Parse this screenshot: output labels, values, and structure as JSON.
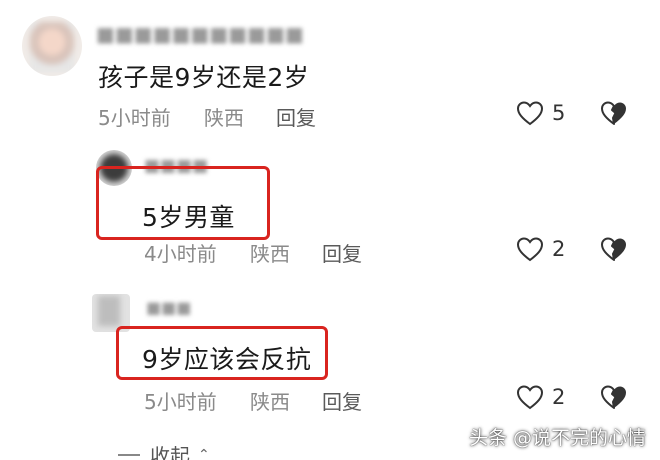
{
  "comments": [
    {
      "text": "孩子是9岁还是2岁",
      "time": "5小时前",
      "location": "陕西",
      "reply_label": "回复",
      "likes": "5",
      "highlighted": false
    },
    {
      "text": "5岁男童",
      "time": "4小时前",
      "location": "陕西",
      "reply_label": "回复",
      "likes": "2",
      "highlighted": true
    },
    {
      "text": "9岁应该会反抗",
      "time": "5小时前",
      "location": "陕西",
      "reply_label": "回复",
      "likes": "2",
      "highlighted": true
    }
  ],
  "collapse_label": "收起",
  "watermark": "头条 @说不完的心情",
  "colors": {
    "highlight_border": "#d9241f",
    "meta_text": "#8a8a8a",
    "body_text": "#1a1a1a"
  },
  "icons": {
    "like": "heart-outline-icon",
    "dislike": "broken-heart-icon",
    "collapse": "chevron-up-icon"
  }
}
